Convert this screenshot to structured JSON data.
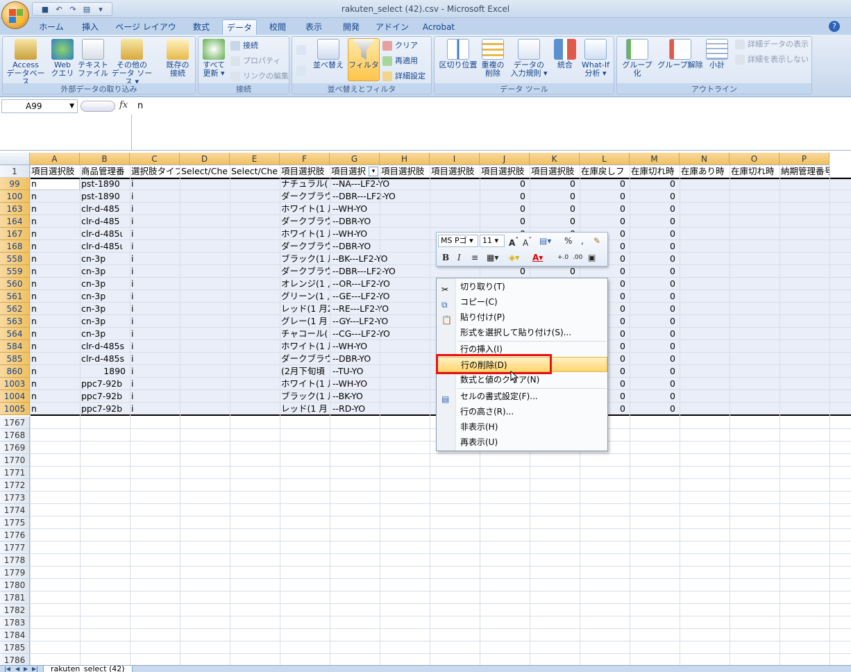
{
  "window": {
    "title": "rakuten_select (42).csv - Microsoft Excel"
  },
  "tabs": [
    "ホーム",
    "挿入",
    "ページ レイアウト",
    "数式",
    "データ",
    "校閲",
    "表示",
    "開発",
    "アドイン",
    "Acrobat"
  ],
  "ribbon": {
    "groups": {
      "external": "外部データの取り込み",
      "connections": "接続",
      "sortfilter": "並べ替えとフィルタ",
      "datatools": "データ ツール",
      "outline": "アウトライン"
    },
    "buttons": {
      "access": [
        "Access",
        "データベース"
      ],
      "web": [
        "Web",
        "クエリ"
      ],
      "text": [
        "テキスト",
        "ファイル"
      ],
      "other": [
        "その他の",
        "データ ソース ▾"
      ],
      "existing": [
        "既存の",
        "接続"
      ],
      "refresh": [
        "すべて",
        "更新 ▾"
      ],
      "conn": "接続",
      "props": "プロパティ",
      "links": "リンクの編集",
      "sort": "並べ替え",
      "filter": "フィルタ",
      "clear": "クリア",
      "reapply": "再適用",
      "advanced": "詳細設定",
      "textcols": "区切り位置",
      "dedupe": [
        "重複の",
        "削除"
      ],
      "validation": [
        "データの",
        "入力規則 ▾"
      ],
      "consolidate": "統合",
      "whatif": [
        "What-If",
        "分析 ▾"
      ],
      "group": "グループ化",
      "ungroup": "グループ解除",
      "subtotal": "小計",
      "showdetail": "詳細データの表示",
      "hidedetail": "詳細を表示しない"
    }
  },
  "formula_bar": {
    "namebox": "A99",
    "fx": "fx",
    "formula": "n"
  },
  "columns": [
    "A",
    "B",
    "C",
    "D",
    "E",
    "F",
    "G",
    "H",
    "I",
    "J",
    "K",
    "L",
    "M",
    "N",
    "O",
    "P"
  ],
  "header_row": {
    "num": "1",
    "cells": [
      "項目選択肢",
      "商品管理番",
      "選択肢タイプ",
      "Select/Che",
      "Select/Che",
      "項目選択肢",
      "項目選択",
      "項目選択肢",
      "項目選択肢",
      "項目選択肢",
      "項目選択肢",
      "在庫戻しフ",
      "在庫切れ時",
      "在庫あり時",
      "在庫切れ時",
      "納期管理番号"
    ]
  },
  "rows": [
    {
      "num": "99",
      "a": "n",
      "b": "pst-1890",
      "c": "i",
      "f": "ナチュラル(",
      "g": "--NA---LF2-YO",
      "j": "0",
      "k": "0",
      "l": "0",
      "m": "0"
    },
    {
      "num": "100",
      "a": "n",
      "b": "pst-1890",
      "c": "i",
      "f": "ダークブラウ",
      "g": "--DBR---LF2-YO",
      "j": "0",
      "k": "0",
      "l": "0",
      "m": "0"
    },
    {
      "num": "163",
      "a": "n",
      "b": "clr-d-485",
      "c": "i",
      "f": "ホワイト(1 月",
      "g": "--WH-YO",
      "j": "0",
      "k": "0",
      "l": "0",
      "m": "0"
    },
    {
      "num": "164",
      "a": "n",
      "b": "clr-d-485",
      "c": "i",
      "f": "ダークブラウ",
      "g": "--DBR-YO",
      "j": "0",
      "k": "0",
      "l": "0",
      "m": "0"
    },
    {
      "num": "167",
      "a": "n",
      "b": "clr-d-485ι",
      "c": "i",
      "f": "ホワイト(1 月",
      "g": "--WH-YO",
      "j": "0",
      "k": "0",
      "l": "0",
      "m": "0"
    },
    {
      "num": "168",
      "a": "n",
      "b": "clr-d-485ι",
      "c": "i",
      "f": "ダークブラウ",
      "g": "--DBR-YO",
      "j": "0",
      "k": "0",
      "l": "0",
      "m": "0"
    },
    {
      "num": "558",
      "a": "n",
      "b": "cn-3p",
      "c": "i",
      "f": "ブラック(1 月",
      "g": "--BK---LF2-YO",
      "j": "0",
      "k": "0",
      "l": "0",
      "m": "0"
    },
    {
      "num": "559",
      "a": "n",
      "b": "cn-3p",
      "c": "i",
      "f": "ダークブラウ",
      "g": "--DBR---LF2-YO",
      "j": "0",
      "k": "0",
      "l": "0",
      "m": "0"
    },
    {
      "num": "560",
      "a": "n",
      "b": "cn-3p",
      "c": "i",
      "f": "オレンジ(1 ,",
      "g": "--OR---LF2-YO",
      "j": "",
      "k": "",
      "l": "0",
      "m": "0"
    },
    {
      "num": "561",
      "a": "n",
      "b": "cn-3p",
      "c": "i",
      "f": "グリーン(1 ,",
      "g": "--GE---LF2-YO",
      "j": "",
      "k": "",
      "l": "0",
      "m": "0"
    },
    {
      "num": "562",
      "a": "n",
      "b": "cn-3p",
      "c": "i",
      "f": "レッド(1 月2",
      "g": "--RE---LF2-YO",
      "j": "",
      "k": "",
      "l": "0",
      "m": "0"
    },
    {
      "num": "563",
      "a": "n",
      "b": "cn-3p",
      "c": "i",
      "f": "グレー(1 月",
      "g": "--GY---LF2-YO",
      "j": "",
      "k": "",
      "l": "0",
      "m": "0"
    },
    {
      "num": "564",
      "a": "n",
      "b": "cn-3p",
      "c": "i",
      "f": "チャコール(",
      "g": "--CG---LF2-YO",
      "j": "",
      "k": "",
      "l": "0",
      "m": "0"
    },
    {
      "num": "584",
      "a": "n",
      "b": "clr-d-485s",
      "c": "i",
      "f": "ホワイト(1 月",
      "g": "--WH-YO",
      "j": "",
      "k": "",
      "l": "0",
      "m": "0"
    },
    {
      "num": "585",
      "a": "n",
      "b": "clr-d-485s",
      "c": "i",
      "f": "ダークブラウ",
      "g": "--DBR-YO",
      "j": "",
      "k": "",
      "l": "0",
      "m": "0"
    },
    {
      "num": "860",
      "a": "n",
      "b": "1890",
      "c": "i",
      "f": "(2月下旬頃",
      "g": "--TU-YO",
      "j": "",
      "k": "",
      "l": "0",
      "m": "0"
    },
    {
      "num": "1003",
      "a": "n",
      "b": "ppc7-92b",
      "c": "i",
      "f": "ホワイト(1 月",
      "g": "--WH-YO",
      "j": "",
      "k": "",
      "l": "0",
      "m": "0"
    },
    {
      "num": "1004",
      "a": "n",
      "b": "ppc7-92b",
      "c": "i",
      "f": "ブラック(1 月",
      "g": "--BK-YO",
      "j": "",
      "k": "",
      "l": "0",
      "m": "0"
    },
    {
      "num": "1005",
      "a": "n",
      "b": "ppc7-92b",
      "c": "i",
      "f": "レッド(1 月",
      "g": "--RD-YO",
      "j": "",
      "k": "",
      "l": "0",
      "m": "0"
    }
  ],
  "empty_rows": [
    "1767",
    "1768",
    "1769",
    "1770",
    "1771",
    "1772",
    "1773",
    "1774",
    "1775",
    "1776",
    "1777",
    "1778",
    "1779",
    "1780",
    "1781",
    "1782",
    "1783",
    "1784",
    "1785",
    "1786"
  ],
  "minibar": {
    "font": "MS Pゴ",
    "size": "11",
    "bold": "B",
    "italic": "I",
    "percent": "%",
    "comma": ","
  },
  "context_menu": {
    "cut": "切り取り(T)",
    "copy": "コピー(C)",
    "paste": "貼り付け(P)",
    "paste_special": "形式を選択して貼り付け(S)...",
    "insert_row": "行の挿入(I)",
    "delete_row": "行の削除(D)",
    "clear": "数式と値のクリア(N)",
    "format_cells": "セルの書式設定(F)...",
    "row_height": "行の高さ(R)...",
    "hide": "非表示(H)",
    "unhide": "再表示(U)"
  },
  "sheet_tab": "rakuten_select (42)",
  "colors": {
    "highlight_box": "#e81010",
    "selection": "#e9eef8"
  }
}
